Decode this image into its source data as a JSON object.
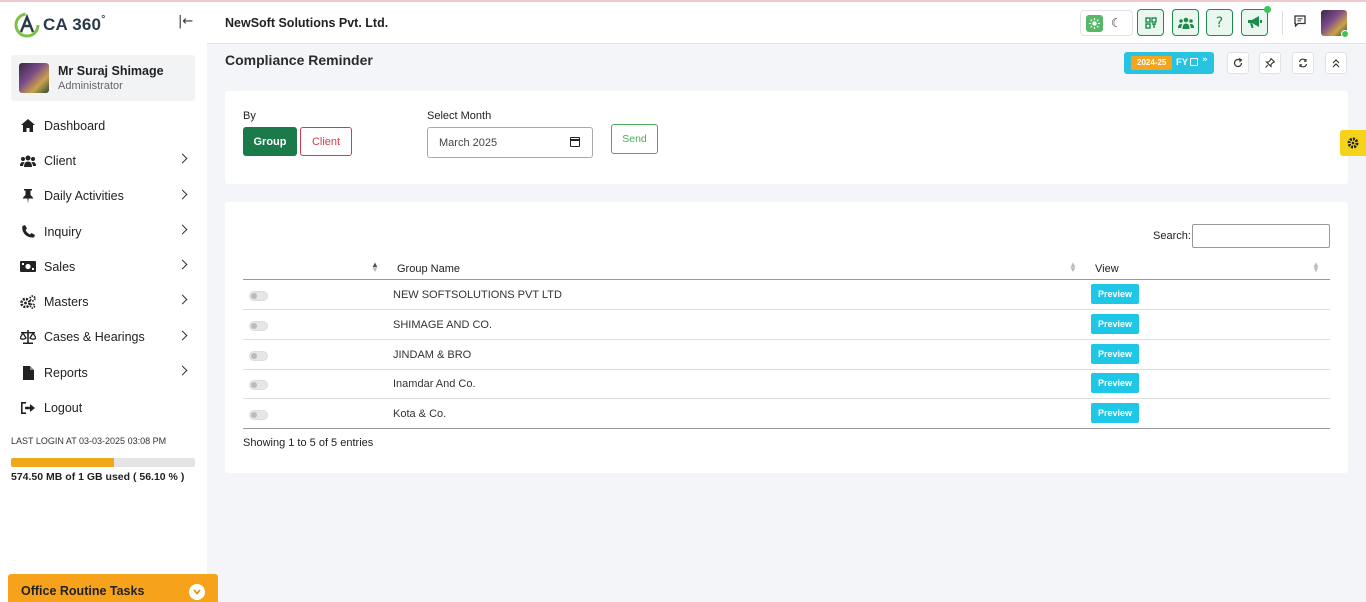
{
  "app": {
    "logo_text": "CA 360",
    "logo_sup": "°"
  },
  "profile": {
    "name": "Mr Suraj Shimage",
    "role": "Administrator"
  },
  "nav": [
    {
      "label": "Dashboard",
      "icon": "home-icon",
      "has_children": false
    },
    {
      "label": "Client",
      "icon": "users-icon",
      "has_children": true
    },
    {
      "label": "Daily Activities",
      "icon": "pin-icon",
      "has_children": true
    },
    {
      "label": "Inquiry",
      "icon": "phone-icon",
      "has_children": true
    },
    {
      "label": "Sales",
      "icon": "money-icon",
      "has_children": true
    },
    {
      "label": "Masters",
      "icon": "cogs-icon",
      "has_children": true
    },
    {
      "label": "Cases & Hearings",
      "icon": "scale-icon",
      "has_children": true
    },
    {
      "label": "Reports",
      "icon": "file-icon",
      "has_children": true
    },
    {
      "label": "Logout",
      "icon": "logout-icon",
      "has_children": false
    }
  ],
  "last_login": "LAST LOGIN AT 03-03-2025 03:08 PM",
  "storage": {
    "used_fraction": 0.561,
    "text": "574.50 MB of 1 GB used ( 56.10 % )"
  },
  "office_tasks": {
    "label": "Office Routine Tasks"
  },
  "header": {
    "company": "NewSoft Solutions Pvt. Ltd."
  },
  "page": {
    "title": "Compliance Reminder"
  },
  "fy": {
    "badge": "2024-25",
    "label": "FY"
  },
  "form": {
    "by_label": "By",
    "group_label": "Group",
    "client_label": "Client",
    "month_label": "Select Month",
    "month_value": "March 2025",
    "send_label": "Send"
  },
  "table": {
    "search_label": "Search:",
    "columns": [
      "Group Name",
      "View"
    ],
    "rows": [
      {
        "name": "NEW SOFTSOLUTIONS PVT LTD",
        "action": "Preview"
      },
      {
        "name": "SHIMAGE AND CO.",
        "action": "Preview"
      },
      {
        "name": "JINDAM & BRO",
        "action": "Preview"
      },
      {
        "name": "Inamdar And Co.",
        "action": "Preview"
      },
      {
        "name": "Kota & Co.",
        "action": "Preview"
      }
    ],
    "footer": "Showing 1 to 5 of 5 entries"
  },
  "colors": {
    "primary": "#1a7a4a",
    "accent": "#27c3e1",
    "warning": "#f7a21b",
    "danger": "#d43a4a"
  }
}
